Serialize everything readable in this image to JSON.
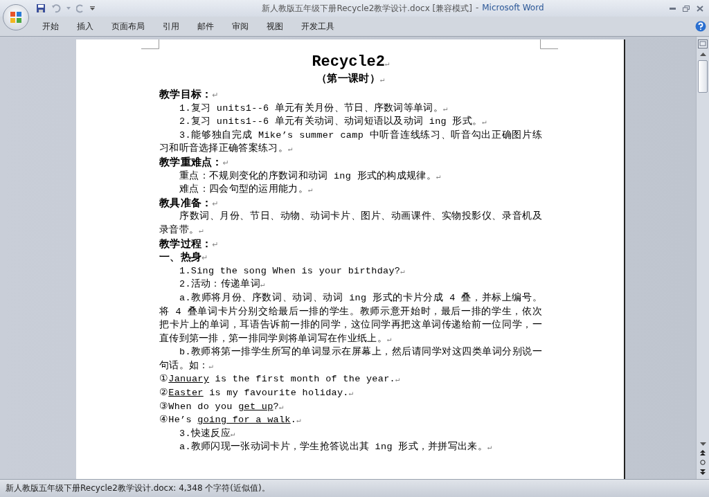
{
  "window": {
    "document_title": "新人教版五年级下册Recycle2教学设计.docx [兼容模式]",
    "separator": "-",
    "app_title": "Microsoft Word"
  },
  "ribbon_tabs": [
    {
      "label": "开始",
      "selected": false
    },
    {
      "label": "插入",
      "selected": false
    },
    {
      "label": "页面布局",
      "selected": false
    },
    {
      "label": "引用",
      "selected": false
    },
    {
      "label": "邮件",
      "selected": false
    },
    {
      "label": "审阅",
      "selected": false
    },
    {
      "label": "视图",
      "selected": false
    },
    {
      "label": "开发工具",
      "selected": false
    }
  ],
  "document": {
    "paragraph_mark": "↵",
    "paragraphs": [
      {
        "kind": "title",
        "runs": [
          {
            "text": "Recycle2"
          }
        ]
      },
      {
        "kind": "subtitle",
        "runs": [
          {
            "text": "（第一课时）"
          }
        ]
      },
      {
        "kind": "heading",
        "runs": [
          {
            "text": "教学目标："
          }
        ]
      },
      {
        "kind": "indented",
        "runs": [
          {
            "text": "1.复习 units1--6 单元有关月份、节日、序数词等单词。"
          }
        ]
      },
      {
        "kind": "indented",
        "runs": [
          {
            "text": "2.复习 units1--6 单元有关动词、动词短语以及动词 ing 形式。"
          }
        ]
      },
      {
        "kind": "indented",
        "runs": [
          {
            "text": "3.能够独自完成 Mike’s summer camp 中听音连线练习、听音勾出正确图片练习和听音选择正确答案练习。"
          }
        ]
      },
      {
        "kind": "heading",
        "runs": [
          {
            "text": "教学重难点："
          }
        ]
      },
      {
        "kind": "indented",
        "runs": [
          {
            "text": "重点：不规则变化的序数词和动词 ing 形式的构成规律。"
          }
        ]
      },
      {
        "kind": "indented",
        "runs": [
          {
            "text": "难点：四会句型的运用能力。"
          }
        ]
      },
      {
        "kind": "heading",
        "runs": [
          {
            "text": "教具准备："
          }
        ]
      },
      {
        "kind": "indented",
        "runs": [
          {
            "text": "序数词、月份、节日、动物、动词卡片、图片、动画课件、实物投影仪、录音机及录音带。"
          }
        ]
      },
      {
        "kind": "heading",
        "runs": [
          {
            "text": "教学过程："
          }
        ]
      },
      {
        "kind": "heading",
        "runs": [
          {
            "text": "一、热身"
          }
        ]
      },
      {
        "kind": "indented",
        "runs": [
          {
            "text": "1.Sing the song When is your birthday?"
          }
        ]
      },
      {
        "kind": "indented",
        "runs": [
          {
            "text": "2.活动：传递单词"
          }
        ]
      },
      {
        "kind": "indented",
        "runs": [
          {
            "text": "a.教师将月份、序数词、动词、动词 ing 形式的卡片分成 4 叠，并标上编号。将 4 叠单词卡片分别交给最后一排的学生。教师示意开始时，最后一排的学生，依次把卡片上的单词，耳语告诉前一排的同学，这位同学再把这单词传递给前一位同学，一直传到第一排，第一排同学则将单词写在作业纸上。"
          }
        ]
      },
      {
        "kind": "indented",
        "runs": [
          {
            "text": "b.教师将第一排学生所写的单词显示在屏幕上，然后请同学对这四类单词分别说一句话。如："
          }
        ]
      },
      {
        "kind": "plain",
        "runs": [
          {
            "text": "①"
          },
          {
            "text": "January",
            "underline": true
          },
          {
            "text": " is the first month of the year."
          }
        ]
      },
      {
        "kind": "plain",
        "runs": [
          {
            "text": "②"
          },
          {
            "text": "Easter",
            "underline": true
          },
          {
            "text": " is my favourite holiday."
          }
        ]
      },
      {
        "kind": "plain",
        "runs": [
          {
            "text": "③When do you "
          },
          {
            "text": "get up",
            "underline": true
          },
          {
            "text": "?"
          }
        ]
      },
      {
        "kind": "plain",
        "runs": [
          {
            "text": "④He’s "
          },
          {
            "text": "going for a walk",
            "underline": true
          },
          {
            "text": "."
          }
        ]
      },
      {
        "kind": "indented",
        "runs": [
          {
            "text": "3.快速反应"
          }
        ]
      },
      {
        "kind": "indented",
        "runs": [
          {
            "text": "a.教师闪现一张动词卡片，学生抢答说出其 ing 形式，并拼写出来。"
          }
        ]
      }
    ]
  },
  "status_bar": {
    "text": "新人教版五年级下册Recycle2教学设计.docx: 4,348 个字符(近似值)。"
  }
}
